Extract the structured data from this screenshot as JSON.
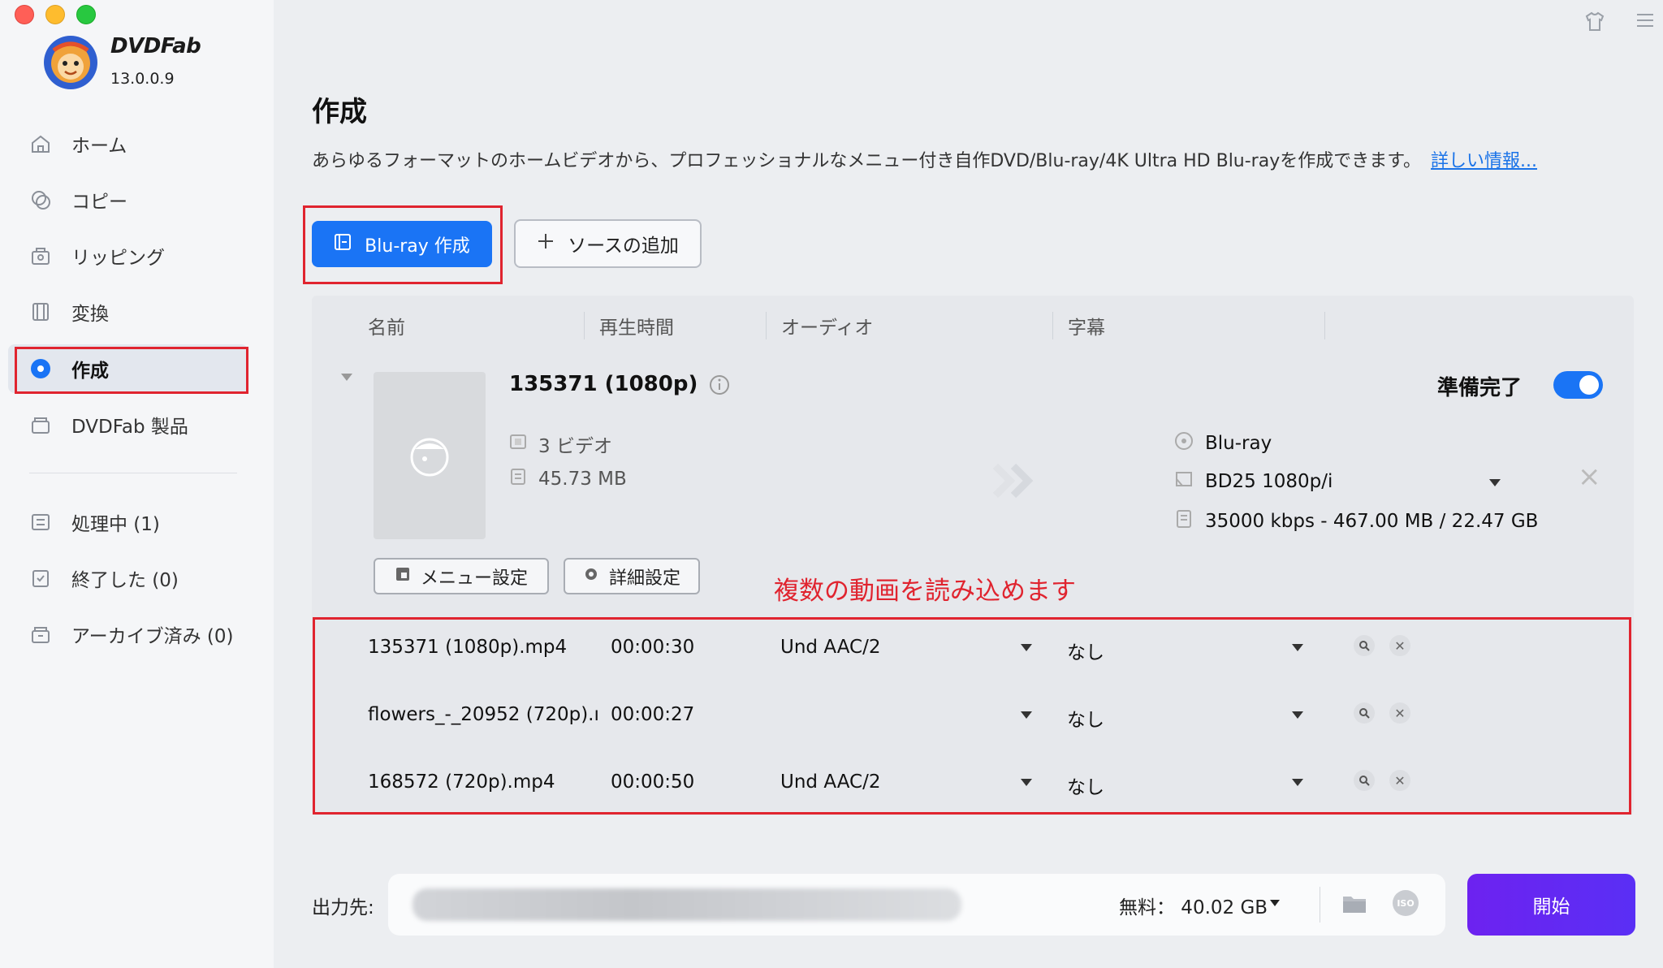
{
  "app": {
    "name": "DVDFab",
    "version": "13.0.0.9"
  },
  "sidebar": {
    "items": [
      {
        "label": "ホーム",
        "icon": "home-icon"
      },
      {
        "label": "コピー",
        "icon": "copy-icon"
      },
      {
        "label": "リッピング",
        "icon": "ripping-icon"
      },
      {
        "label": "変換",
        "icon": "convert-icon"
      },
      {
        "label": "作成",
        "icon": "create-icon",
        "active": true
      },
      {
        "label": "DVDFab 製品",
        "icon": "products-icon"
      }
    ],
    "queue": [
      {
        "label": "処理中 (1)",
        "icon": "processing-icon"
      },
      {
        "label": "終了した (0)",
        "icon": "finished-icon"
      },
      {
        "label": "アーカイブ済み (0)",
        "icon": "archive-icon"
      }
    ]
  },
  "main": {
    "title": "作成",
    "description": "あらゆるフォーマットのホームビデオから、プロフェッショナルなメニュー付き自作DVD/Blu-ray/4K Ultra HD Blu-rayを作成できます。",
    "more_link": "詳しい情報...",
    "create_button": "Blu-ray 作成",
    "add_source_button": "ソースの追加",
    "columns": [
      "名前",
      "再生時間",
      "オーディオ",
      "字幕"
    ]
  },
  "item": {
    "title": "135371 (1080p)",
    "videos": "3 ビデオ",
    "size": "45.73 MB",
    "status": "準備完了",
    "enabled": true,
    "output_type": "Blu-ray",
    "output_profile": "BD25 1080p/i",
    "output_bitrate": "35000 kbps - 467.00 MB / 22.47 GB",
    "menu_button": "メニュー設定",
    "advanced_button": "詳細設定"
  },
  "annotation": "複数の動画を読み込めます",
  "rows": [
    {
      "name": "135371 (1080p).mp4",
      "duration": "00:00:30",
      "audio": "Und  AAC/2",
      "subtitle": "なし"
    },
    {
      "name": "flowers_-_20952 (720p).ı",
      "duration": "00:00:27",
      "audio": "",
      "subtitle": "なし"
    },
    {
      "name": "168572 (720p).mp4",
      "duration": "00:00:50",
      "audio": "Und  AAC/2",
      "subtitle": "なし"
    }
  ],
  "footer": {
    "output_label": "出力先:",
    "free_space": "無料： 40.02 GB",
    "iso_label": "ISO",
    "start_button": "開始"
  },
  "colors": {
    "accent": "#1a74f5",
    "start": "#6d22f0",
    "highlight": "#e0242f"
  }
}
